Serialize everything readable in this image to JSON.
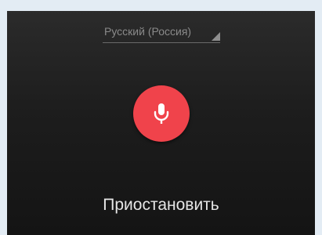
{
  "language_selector": {
    "label": "Русский (Россия)"
  },
  "mic_button": {
    "icon": "microphone-icon",
    "color": "#f0434b"
  },
  "status": {
    "text": "Приостановить"
  }
}
